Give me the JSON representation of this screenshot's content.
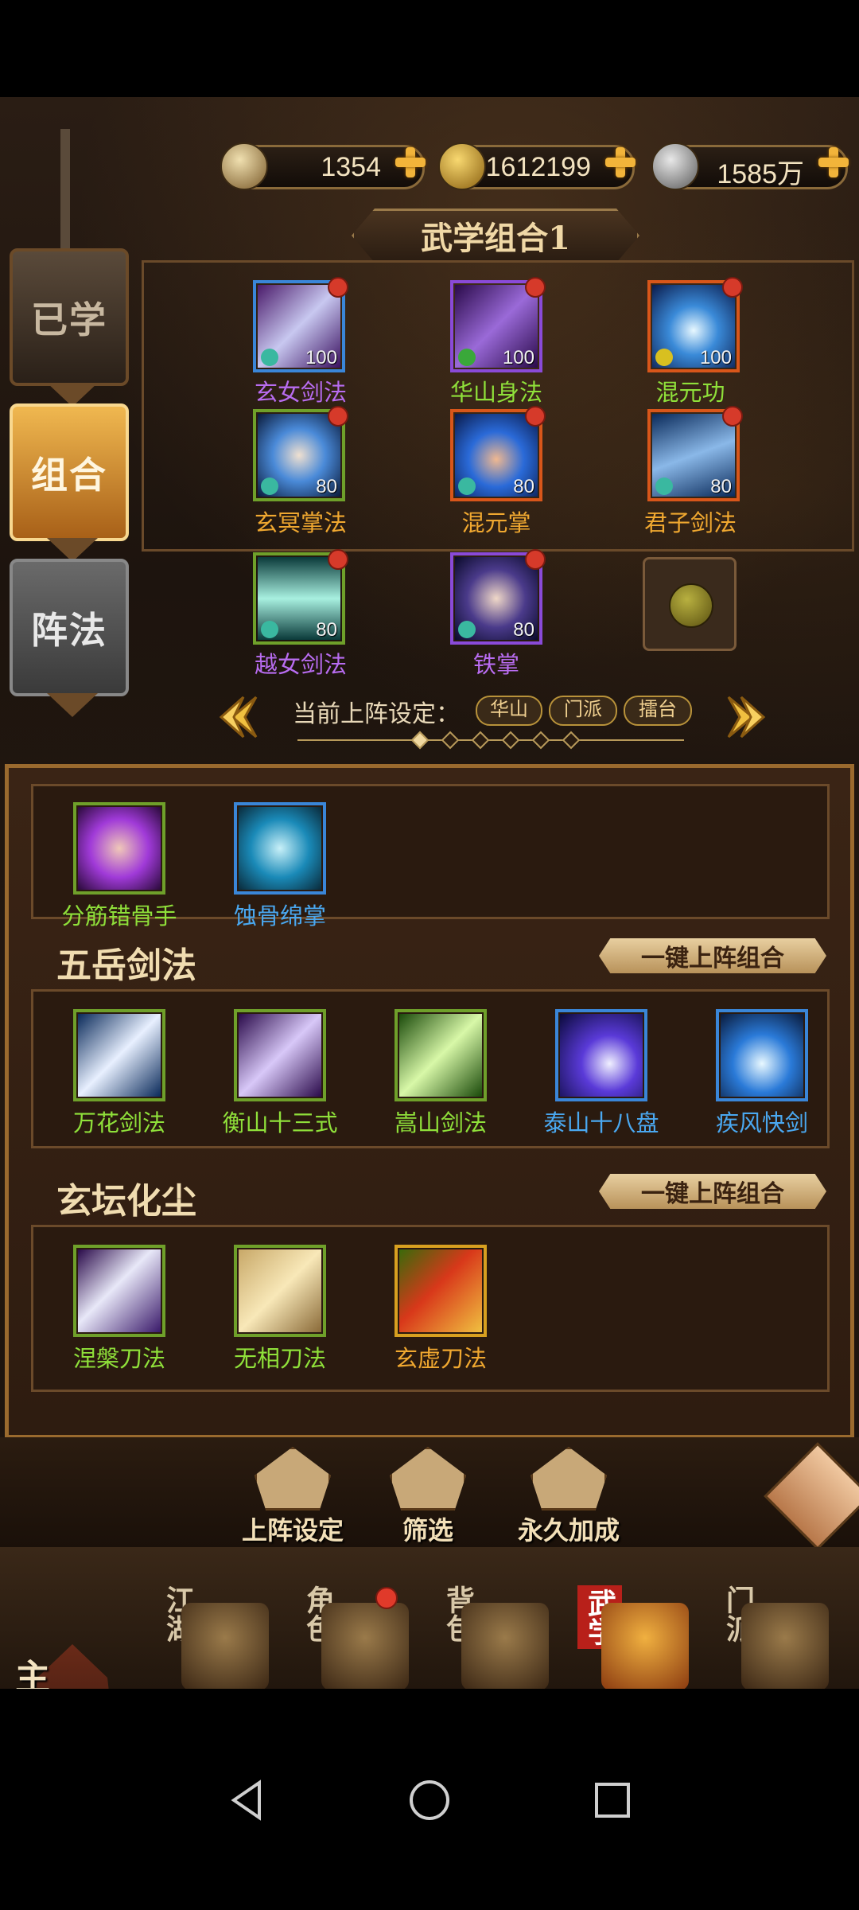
{
  "currencies": [
    {
      "icon": "sword-token-icon",
      "value": "1354"
    },
    {
      "icon": "gold-ingot-icon",
      "value": "1612199"
    },
    {
      "icon": "silver-coin-icon",
      "value": "1585万"
    }
  ],
  "side_tabs": [
    {
      "label": "已学",
      "active": false
    },
    {
      "label": "组合",
      "active": true
    },
    {
      "label": "阵法",
      "active": false
    }
  ],
  "combo": {
    "title": "武学组合1",
    "slots": [
      {
        "name": "玄女剑法",
        "level": "100",
        "color": "purple"
      },
      {
        "name": "华山身法",
        "level": "100",
        "color": "green"
      },
      {
        "name": "混元功",
        "level": "100",
        "color": "green"
      },
      {
        "name": "玄冥掌法",
        "level": "80",
        "color": "gold"
      },
      {
        "name": "混元掌",
        "level": "80",
        "color": "gold"
      },
      {
        "name": "君子剑法",
        "level": "80",
        "color": "gold"
      },
      {
        "name": "越女剑法",
        "level": "80",
        "color": "purple"
      },
      {
        "name": "铁掌",
        "level": "80",
        "color": "purple"
      }
    ],
    "deploy_label": "当前上阵设定：",
    "deploy_tags": [
      "华山",
      "门派",
      "擂台"
    ]
  },
  "skill_groups": [
    {
      "title": "",
      "skills": [
        {
          "name": "分筋错骨手",
          "color": "green"
        },
        {
          "name": "蚀骨绵掌",
          "color": "sky"
        }
      ]
    },
    {
      "title": "五岳剑法",
      "button": "一键上阵组合",
      "skills": [
        {
          "name": "万花剑法",
          "color": "green"
        },
        {
          "name": "衡山十三式",
          "color": "green"
        },
        {
          "name": "嵩山剑法",
          "color": "green"
        },
        {
          "name": "泰山十八盘",
          "color": "sky"
        },
        {
          "name": "疾风快剑",
          "color": "sky"
        }
      ]
    },
    {
      "title": "玄坛化尘",
      "button": "一键上阵组合",
      "skills": [
        {
          "name": "涅槃刀法",
          "color": "green"
        },
        {
          "name": "无相刀法",
          "color": "green"
        },
        {
          "name": "玄虚刀法",
          "color": "gold"
        }
      ]
    }
  ],
  "actions": [
    "上阵设定",
    "筛选",
    "永久加成"
  ],
  "main_nav": {
    "home": "主城",
    "items": [
      {
        "label": "江湖",
        "active": false
      },
      {
        "label": "角色",
        "active": false
      },
      {
        "label": "背包",
        "active": false
      },
      {
        "label": "武学",
        "active": true
      },
      {
        "label": "门派",
        "active": false
      }
    ]
  }
}
